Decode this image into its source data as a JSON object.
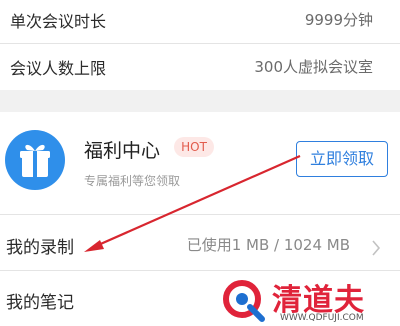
{
  "settings": {
    "rows": [
      {
        "label": "单次会议时长",
        "value": "9999分钟"
      },
      {
        "label": "会议人数上限",
        "value": "300人虚拟会议室"
      }
    ]
  },
  "welfare": {
    "title": "福利中心",
    "badge": "HOT",
    "subtitle": "专属福利等您领取",
    "claim_label": "立即领取",
    "icon": "gift-icon"
  },
  "recording": {
    "label": "我的录制",
    "usage": "已使用1 MB / 1024 MB"
  },
  "notes": {
    "label": "我的笔记"
  },
  "watermark": {
    "name": "清道夫",
    "url": "WWW.QDFUJI.COM"
  },
  "colors": {
    "accent_blue": "#2f7fde",
    "annotation_red": "#d8262f",
    "hot_text": "#e25c4d"
  }
}
